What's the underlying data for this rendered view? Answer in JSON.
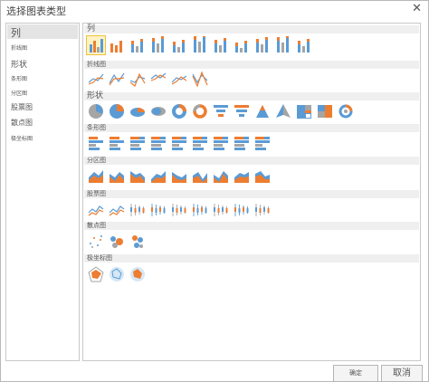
{
  "dialog": {
    "title": "选择图表类型",
    "close_glyph": "✕"
  },
  "categories": [
    "列",
    "折线图",
    "形状",
    "条形图",
    "分区图",
    "股票图",
    "散点图",
    "极坐标图"
  ],
  "sections": [
    "列",
    "折线图",
    "形状",
    "条形图",
    "分区图",
    "股票图",
    "散点图",
    "极坐标图"
  ],
  "buttons": {
    "ok": "确定",
    "cancel": "取消"
  },
  "colors": {
    "blue": "#5b9bd5",
    "orange": "#ed7d31",
    "gray": "#a5a5a5",
    "gold": "#ffc000",
    "selected": "#fff3c4"
  }
}
